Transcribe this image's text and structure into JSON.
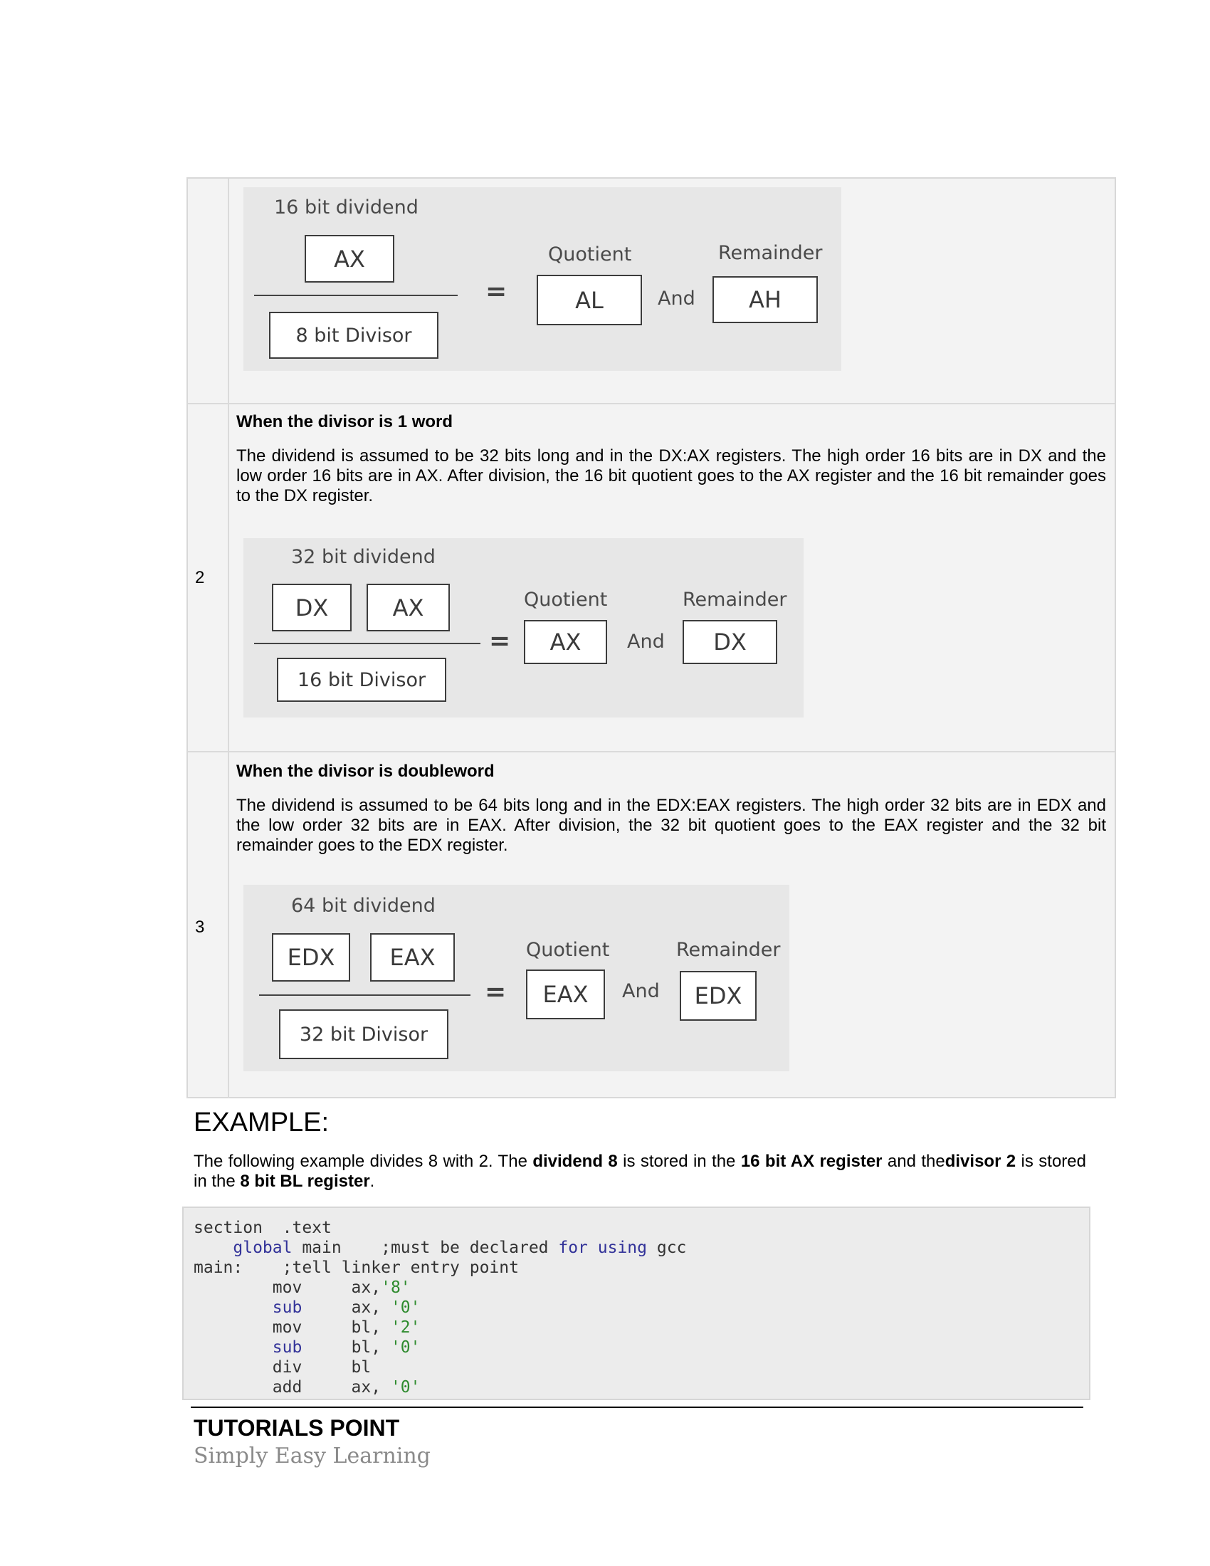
{
  "table": {
    "rows": [
      {
        "number": "",
        "diagram": {
          "dividend_label": "16 bit dividend",
          "dividend_regs": [
            "AX"
          ],
          "divisor": "8 bit Divisor",
          "equals": "=",
          "quotient_label": "Quotient",
          "quotient": "AL",
          "and_label": "And",
          "remainder_label": "Remainder",
          "remainder": "AH"
        }
      },
      {
        "number": "2",
        "heading": "When the divisor is 1 word",
        "text": "The dividend is assumed to be 32 bits long and in the DX:AX registers. The high order 16 bits are in DX and the low order 16 bits are in AX. After division, the 16 bit quotient goes to the AX register and the 16 bit remainder goes to the DX register.",
        "diagram": {
          "dividend_label": "32 bit dividend",
          "dividend_regs": [
            "DX",
            "AX"
          ],
          "divisor": "16 bit Divisor",
          "equals": "=",
          "quotient_label": "Quotient",
          "quotient": "AX",
          "and_label": "And",
          "remainder_label": "Remainder",
          "remainder": "DX"
        }
      },
      {
        "number": "3",
        "heading": "When the divisor is doubleword",
        "text": "The dividend is assumed to be 64 bits long and in the EDX:EAX registers. The high order 32 bits are in EDX and the low order 32 bits are in EAX. After division, the 32 bit quotient goes to the EAX register and the 32 bit remainder goes to the EDX register.",
        "diagram": {
          "dividend_label": "64 bit dividend",
          "dividend_regs": [
            "EDX",
            "EAX"
          ],
          "divisor": "32 bit Divisor",
          "equals": "=",
          "quotient_label": "Quotient",
          "quotient": "EAX",
          "and_label": "And",
          "remainder_label": "Remainder",
          "remainder": "EDX"
        }
      }
    ]
  },
  "example": {
    "title": "EXAMPLE:",
    "para_1": "The following example divides 8 with 2. The ",
    "para_b1": "dividend 8",
    "para_2": " is stored in the ",
    "para_b2": "16 bit AX register",
    "para_3": " and the",
    "para_b3": "divisor 2",
    "para_4": " is stored in the ",
    "para_b4": "8 bit BL register",
    "para_5": "."
  },
  "code": {
    "l1_a": "section  .text",
    "l2_indent": "    ",
    "l2_kw": "global",
    "l2_b": " main    ;must be declared ",
    "l2_kw2": "for",
    "l2_sp": " ",
    "l2_kw3": "using",
    "l2_c": " gcc",
    "l3": "main:    ;tell linker entry point",
    "l4_a": "        mov     ax,",
    "l4_s": "'8'",
    "l5_i": "        ",
    "l5_kw": "sub",
    "l5_a": "     ax, ",
    "l5_s": "'0'",
    "l6_a": "        mov     bl, ",
    "l6_s": "'2'",
    "l7_i": "        ",
    "l7_kw": "sub",
    "l7_a": "     bl, ",
    "l7_s": "'0'",
    "l8": "        div     bl",
    "l9_a": "        add     ax, ",
    "l9_s": "'0'"
  },
  "footer": {
    "title": "TUTORIALS POINT",
    "subtitle": "Simply Easy Learning"
  }
}
